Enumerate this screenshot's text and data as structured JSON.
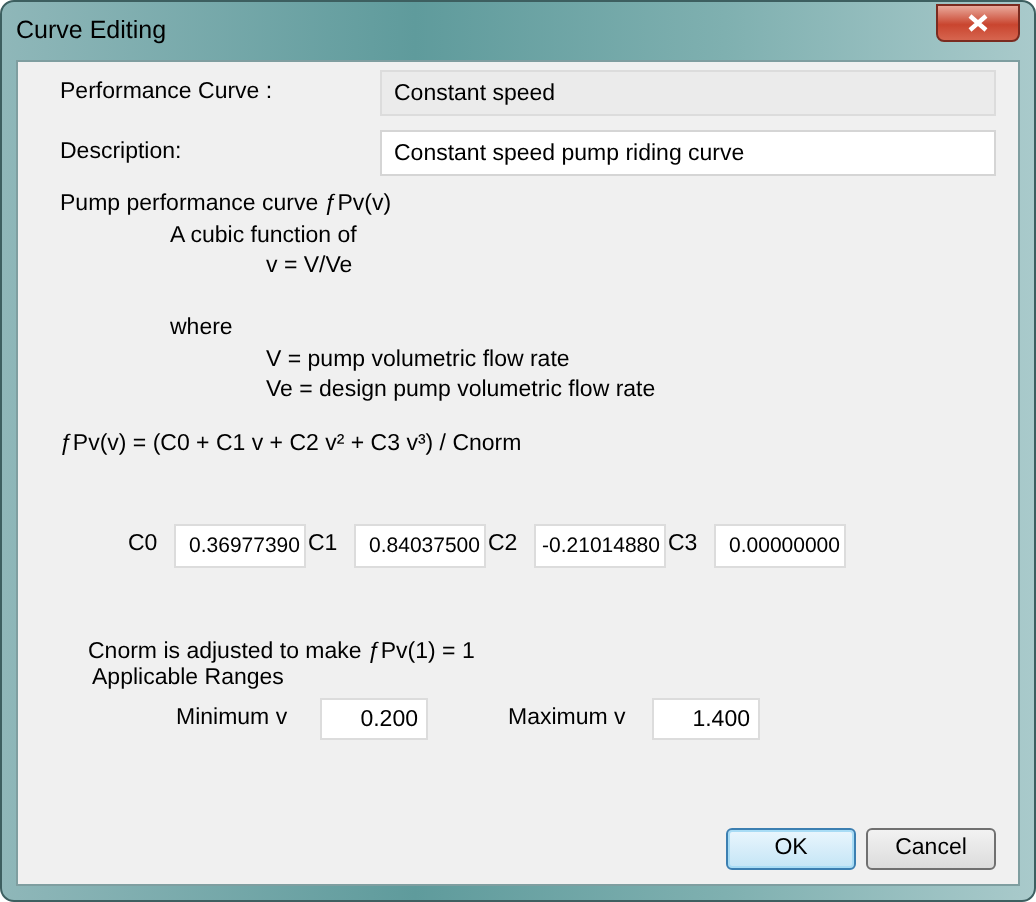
{
  "window": {
    "title": "Curve Editing"
  },
  "fields": [
    {
      "label": "Performance Curve :",
      "value": "Constant speed",
      "readonly": true
    },
    {
      "label": "Description:",
      "value": "Constant speed pump riding curve",
      "readonly": false
    }
  ],
  "explanation": [
    {
      "kind": "heading",
      "text": "Pump performance curve ƒPv(v)"
    },
    {
      "kind": "sub",
      "text": "A cubic function of"
    },
    {
      "kind": "detail",
      "text": "v = V/Ve"
    },
    {
      "kind": "gap"
    },
    {
      "kind": "sub",
      "text": "where"
    },
    {
      "kind": "detail",
      "text": "V = pump volumetric flow rate"
    },
    {
      "kind": "detail",
      "text": "Ve = design pump volumetric flow rate"
    }
  ],
  "formula": "ƒPv(v) = (C0 + C1 v + C2 v² + C3 v³) / Cnorm",
  "coefficients": [
    {
      "label": "C0",
      "value": "0.36977390"
    },
    {
      "label": "C1",
      "value": "0.84037500"
    },
    {
      "label": "C2",
      "value": "-0.21014880"
    },
    {
      "label": "C3",
      "value": "0.00000000"
    }
  ],
  "normalization_note": "Cnorm is adjusted to make ƒPv(1) = 1",
  "ranges": {
    "heading": "Applicable Ranges",
    "items": [
      {
        "label": "Minimum v",
        "value": "0.200"
      },
      {
        "label": "Maximum v",
        "value": "1.400"
      }
    ]
  },
  "buttons": [
    {
      "label": "OK",
      "default": true
    },
    {
      "label": "Cancel",
      "default": false
    }
  ]
}
